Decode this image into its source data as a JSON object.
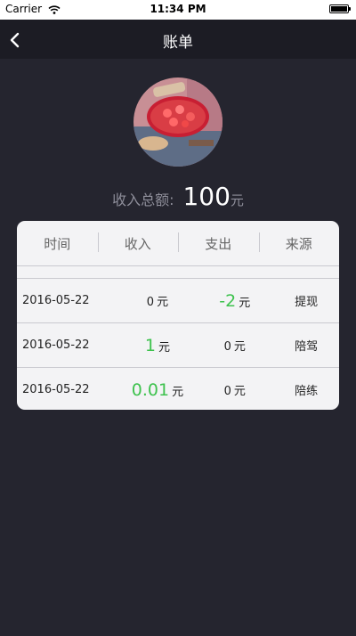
{
  "status": {
    "carrier": "Carrier",
    "time": "11:34 PM"
  },
  "nav": {
    "title": "账单"
  },
  "summary": {
    "label": "收入总额:",
    "value": "100",
    "unit": "元"
  },
  "table": {
    "headers": [
      "时间",
      "收入",
      "支出",
      "来源"
    ],
    "rows": [
      {
        "date": "2016-05-22",
        "income": "0",
        "income_unit": "元",
        "expense": "-2",
        "expense_unit": "元",
        "source": "提现"
      },
      {
        "date": "2016-05-22",
        "income": "1",
        "income_unit": "元",
        "expense": "0",
        "expense_unit": "元",
        "source": "陪驾"
      },
      {
        "date": "2016-05-22",
        "income": "0.01",
        "income_unit": "元",
        "expense": "0",
        "expense_unit": "元",
        "source": "陪练"
      }
    ]
  },
  "colors": {
    "background": "#25252f",
    "nav": "#1c1c24",
    "card": "#f3f3f5",
    "accent_green": "#3ec24e"
  }
}
